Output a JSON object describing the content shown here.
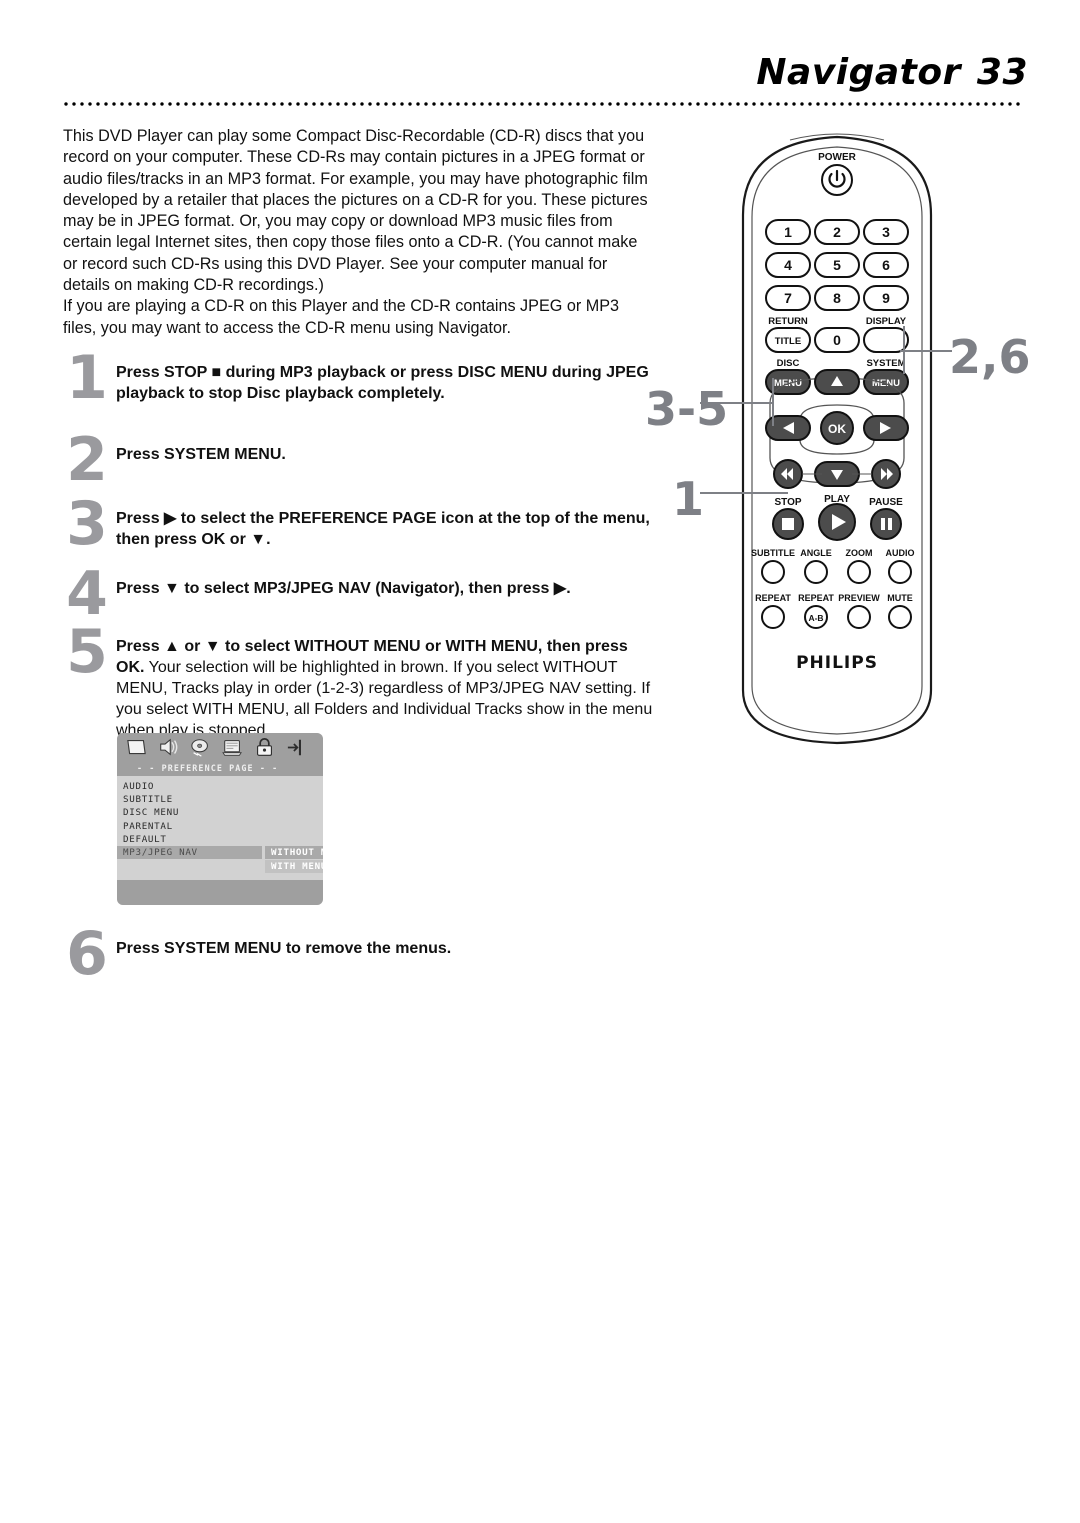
{
  "header": {
    "title": "Navigator",
    "page_number": "33"
  },
  "intro": {
    "paragraph1": "This DVD Player can play some Compact Disc-Recordable (CD-R) discs that you record on your computer. These CD-Rs may contain pictures in a JPEG format or audio files/tracks in an MP3 format. For example, you may have photographic film developed by a retailer that places the pictures on a CD-R for you. These pictures may be in JPEG format. Or, you may copy or download MP3 music files from certain legal Internet sites, then copy those files onto a CD-R.  (You cannot make or record such CD-Rs using this DVD Player. See your computer manual for details on making CD-R recordings.)",
    "paragraph2": "If you are playing a CD-R on this Player and the CD-R contains JPEG or MP3 files, you may want to access the CD-R menu using Navigator."
  },
  "steps": [
    {
      "number": "1",
      "bold": "Press STOP ■ during MP3 playback or press DISC MENU during JPEG playback to stop Disc playback completely.",
      "normal": ""
    },
    {
      "number": "2",
      "bold": "Press SYSTEM MENU.",
      "normal": ""
    },
    {
      "number": "3",
      "bold": "Press ▶ to select the PREFERENCE PAGE icon at the top of the menu, then press OK or ▼.",
      "normal": ""
    },
    {
      "number": "4",
      "bold": "Press ▼ to select MP3/JPEG NAV (Navigator), then press ▶.",
      "normal": ""
    },
    {
      "number": "5",
      "bold": "Press ▲ or ▼ to select WITHOUT MENU or WITH MENU, then press OK.",
      "normal": " Your selection will be highlighted in brown. If you select WITHOUT MENU, Tracks play in order (1-2-3) regardless of MP3/JPEG NAV setting. If you select WITH MENU,  all Folders and Individual Tracks show in the menu when play is stopped."
    },
    {
      "number": "6",
      "bold": "Press SYSTEM MENU to remove the menus.",
      "normal": ""
    }
  ],
  "osd": {
    "icons": [
      "video-screen-icon",
      "speaker-audio-icon",
      "disc-icon",
      "preference-page-icon",
      "parental-lock-icon",
      "exit-setup-icon"
    ],
    "title": "- -  PREFERENCE  PAGE  - -",
    "rows": [
      {
        "label": "AUDIO",
        "selected": false
      },
      {
        "label": "SUBTITLE",
        "selected": false
      },
      {
        "label": "DISC MENU",
        "selected": false
      },
      {
        "label": "PARENTAL",
        "selected": false
      },
      {
        "label": "DEFAULT",
        "selected": false
      },
      {
        "label": "MP3/JPEG NAV",
        "selected": true
      }
    ],
    "submenu": [
      {
        "label": "WITHOUT MENU",
        "highlighted": true
      },
      {
        "label": "WITH MENU",
        "highlighted": false
      }
    ]
  },
  "remote": {
    "brand": "PHILIPS",
    "power_label": "POWER",
    "numeric_keys": [
      "1",
      "2",
      "3",
      "4",
      "5",
      "6",
      "7",
      "8",
      "9",
      "0"
    ],
    "return_label": "RETURN",
    "title_key": "TITLE",
    "display_label": "DISPLAY",
    "disc_label": "DISC",
    "disc_menu_key": "MENU",
    "system_label": "SYSTEM",
    "system_menu_key": "MENU",
    "ok_key": "OK",
    "stop_label": "STOP",
    "play_label": "PLAY",
    "pause_label": "PAUSE",
    "function_row1": [
      "SUBTITLE",
      "ANGLE",
      "ZOOM",
      "AUDIO"
    ],
    "function_row2": [
      "REPEAT",
      "REPEAT",
      "PREVIEW",
      "MUTE"
    ],
    "repeat_ab_key": "A-B"
  },
  "callouts": [
    {
      "id": "callout-2-6",
      "label": "2,6"
    },
    {
      "id": "callout-3-5",
      "label": "3-5"
    },
    {
      "id": "callout-1",
      "label": "1"
    }
  ],
  "colors": {
    "callout_gray": "#7e8086",
    "step_number_gray": "#9a9a9e",
    "osd_bg": "#d2d2d2",
    "osd_bar": "#9f9f9f",
    "osd_highlight": "#a9a9a9"
  }
}
